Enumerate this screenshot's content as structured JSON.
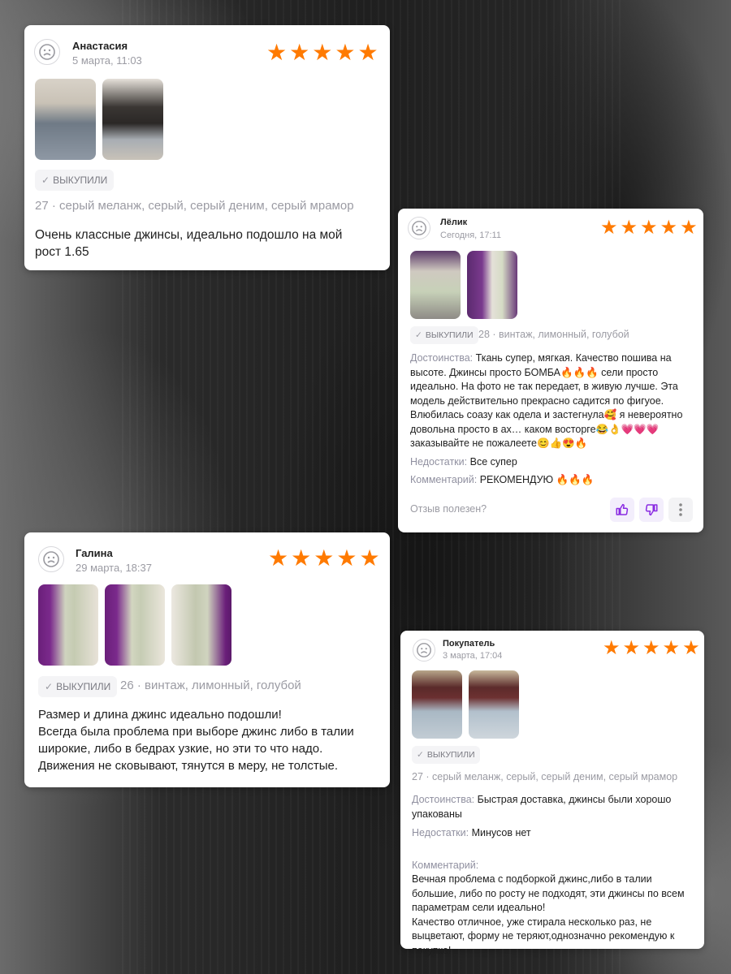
{
  "reviews": [
    {
      "name": "Анастасия",
      "date": "5 марта, 11:03",
      "rating": 5,
      "badge": "ВЫКУПИЛИ",
      "variant": "27 · серый меланж, серый, серый деним, серый мрамор",
      "text": "Очень классные джинсы, идеально подошло на мой рост 1.65"
    },
    {
      "name": "Лёлик",
      "date": "Сегодня, 17:11",
      "rating": 5,
      "badge": "ВЫКУПИЛИ",
      "variant": "28 · винтаж, лимонный, голубой",
      "pros_label": "Достоинства:",
      "pros": "Ткань супер, мягкая. Качество пошива на высоте. Джинсы просто БОМБА🔥🔥🔥 сели просто идеально. На фото не так передает, в живую лучше. Эта модель действительно прекрасно садится по фигуое. Влюбилась соазу как одела и застегнула🥰 я невероятно довольна просто в ах… каком восторге😂👌💗💗💗 заказывайте не пожалеете😊👍😍🔥",
      "cons_label": "Недостатки:",
      "cons": "Все супер",
      "comment_label": "Комментарий:",
      "comment": "РЕКОМЕНДУЮ 🔥🔥🔥",
      "helpful": "Отзыв полезен?"
    },
    {
      "name": "Галина",
      "date": "29 марта, 18:37",
      "rating": 5,
      "badge": "ВЫКУПИЛИ",
      "variant": "26 · винтаж, лимонный, голубой",
      "text": "Размер и длина джинс идеально подошли!\nВсегда была проблема при выборе джинс либо в талии широкие, либо в бедрах узкие, но эти то что надо.\nДвижения не сковывают, тянутся в меру, не толстые."
    },
    {
      "name": "Покупатель",
      "date": "3 марта, 17:04",
      "rating": 5,
      "badge": "ВЫКУПИЛИ",
      "variant": "27 · серый меланж, серый, серый деним, серый мрамор",
      "pros_label": "Достоинства:",
      "pros": "Быстрая доставка, джинсы были хорошо упакованы",
      "cons_label": "Недостатки:",
      "cons": "Минусов нет",
      "comment_label": "Комментарий:",
      "comment": "Вечная проблема с подборкой джинс,либо в талии большие, либо по росту не подходят, эти джинсы по всем параметрам сели идеально!\nКачество отличное, уже стирала несколько раз, не выцветают, форму не теряют,однозначно рекомендую к покупке!"
    }
  ],
  "colors": {
    "star": "#ff7a00",
    "accent": "#8a2be2"
  },
  "icons": {
    "avatar": "sad-face-icon",
    "star": "star-icon",
    "check": "check-icon",
    "like": "thumbs-up-icon",
    "dislike": "thumbs-down-icon",
    "more": "more-vertical-icon"
  }
}
